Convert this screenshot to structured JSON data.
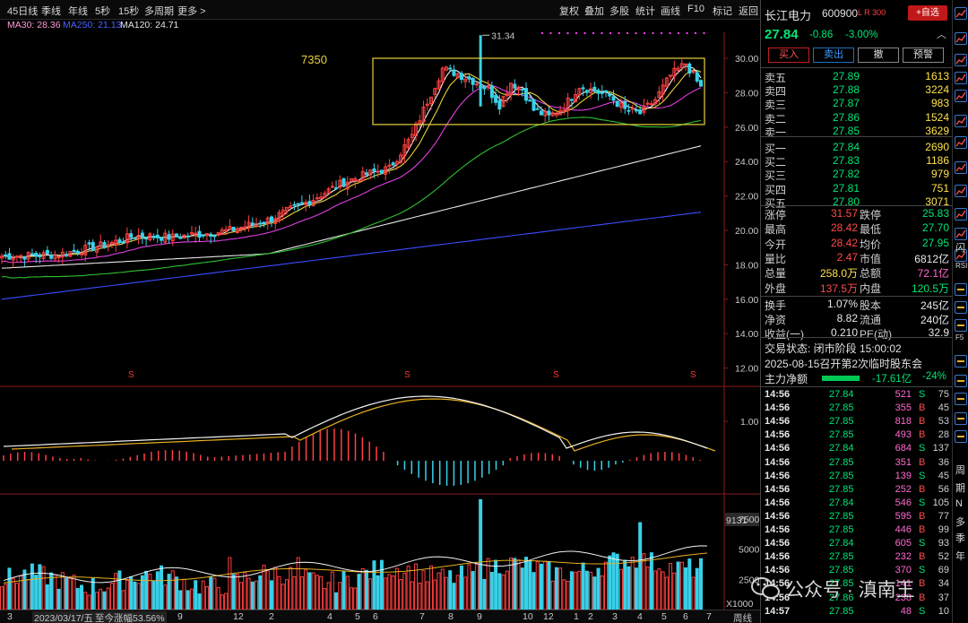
{
  "toolbar": {
    "left": [
      "45日线",
      "季线",
      "年线",
      "5秒",
      "15秒",
      "多周期",
      "更多"
    ],
    "right": [
      "复权",
      "叠加",
      "多股",
      "统计",
      "画线",
      "F10",
      "标记",
      "返回"
    ]
  },
  "ma_legend": {
    "ma30": "MA30: 28.36",
    "ma250": "MA250: 21.13",
    "ma120": "MA120: 24.71",
    "ma30_color": "#ff9ad5",
    "ma250_color": "#4a64ff",
    "ma120_color": "#e6e6e6"
  },
  "main_chart": {
    "y_ticks": [
      "30.00",
      "28.00",
      "26.00",
      "24.00",
      "22.00",
      "20.00",
      "18.00",
      "16.00",
      "14.00",
      "12.00"
    ],
    "box_label": "7350",
    "high_label": "31.34",
    "s_marker": "S"
  },
  "macd": {
    "tick": "1.00"
  },
  "volume": {
    "top_label": "9131",
    "ticks": [
      "7500",
      "5000",
      "2500"
    ],
    "unit": "X1000"
  },
  "bottom_bar": {
    "date": "2023/03/17/五",
    "change": "至今涨幅53.56%",
    "months": [
      "3",
      "9",
      "12",
      "2",
      "4",
      "5",
      "6",
      "7",
      "8",
      "9",
      "10",
      "12",
      "1",
      "2",
      "3",
      "4",
      "5",
      "6",
      "7"
    ],
    "period": "周线"
  },
  "quote": {
    "name": "长江电力",
    "code": "600900",
    "flags": "L R 300",
    "add_button": "+自选",
    "price": "27.84",
    "change": "-0.86",
    "change_pct": "-3.00%",
    "chevron": "︿",
    "buy": "买入",
    "sell": "卖出",
    "cancel": "撤",
    "preorder": "预警"
  },
  "order_book": {
    "asks": [
      {
        "label": "卖五",
        "price": "27.89",
        "vol": "1613"
      },
      {
        "label": "卖四",
        "price": "27.88",
        "vol": "3224"
      },
      {
        "label": "卖三",
        "price": "27.87",
        "vol": "983"
      },
      {
        "label": "卖二",
        "price": "27.86",
        "vol": "1524"
      },
      {
        "label": "卖一",
        "price": "27.85",
        "vol": "3629"
      }
    ],
    "bids": [
      {
        "label": "买一",
        "price": "27.84",
        "vol": "2690"
      },
      {
        "label": "买二",
        "price": "27.83",
        "vol": "1186"
      },
      {
        "label": "买三",
        "price": "27.82",
        "vol": "979"
      },
      {
        "label": "买四",
        "price": "27.81",
        "vol": "751"
      },
      {
        "label": "买五",
        "price": "27.80",
        "vol": "3071"
      }
    ]
  },
  "stats": [
    {
      "l1": "涨停",
      "v1": "31.57",
      "c1": "#ff4a4a",
      "l2": "跌停",
      "v2": "25.83",
      "c2": "#00e676"
    },
    {
      "l1": "最高",
      "v1": "28.42",
      "c1": "#ff4a4a",
      "l2": "最低",
      "v2": "27.70",
      "c2": "#00e676"
    },
    {
      "l1": "今开",
      "v1": "28.42",
      "c1": "#ff4a4a",
      "l2": "均价",
      "v2": "27.95",
      "c2": "#00e676"
    },
    {
      "l1": "量比",
      "v1": "2.47",
      "c1": "#ff4a4a",
      "l2": "市值",
      "v2": "6812亿",
      "c2": "#e8e8e8"
    },
    {
      "l1": "总量",
      "v1": "258.0万",
      "c1": "#ffe24a",
      "l2": "总额",
      "v2": "72.1亿",
      "c2": "#ff6ad0"
    },
    {
      "l1": "外盘",
      "v1": "137.5万",
      "c1": "#ff4a4a",
      "l2": "内盘",
      "v2": "120.5万",
      "c2": "#00e676"
    },
    {
      "l1": "换手",
      "v1": "1.07%",
      "c1": "#e8e8e8",
      "l2": "股本",
      "v2": "245亿",
      "c2": "#e8e8e8"
    },
    {
      "l1": "净资",
      "v1": "8.82",
      "c1": "#e8e8e8",
      "l2": "流通",
      "v2": "240亿",
      "c2": "#e8e8e8"
    },
    {
      "l1": "收益(一)",
      "v1": "0.210",
      "c1": "#e8e8e8",
      "l2": "PE(动)",
      "v2": "32.9",
      "c2": "#e8e8e8"
    }
  ],
  "status": {
    "trade_state": "交易状态: 闭市阶段 15:00:02",
    "announcement": "2025-08-15召开第2次临时股东会",
    "net_flow_label": "主力净额",
    "net_flow_value": "-17.61亿",
    "net_flow_pct": "-24%"
  },
  "ticks": [
    {
      "t": "14:56",
      "p": "27.84",
      "v": "521",
      "d": "S",
      "n": "75"
    },
    {
      "t": "14:56",
      "p": "27.85",
      "v": "355",
      "d": "B",
      "n": "45"
    },
    {
      "t": "14:56",
      "p": "27.85",
      "v": "818",
      "d": "B",
      "n": "53"
    },
    {
      "t": "14:56",
      "p": "27.85",
      "v": "493",
      "d": "B",
      "n": "28"
    },
    {
      "t": "14:56",
      "p": "27.84",
      "v": "684",
      "d": "S",
      "n": "137"
    },
    {
      "t": "14:56",
      "p": "27.85",
      "v": "351",
      "d": "B",
      "n": "36"
    },
    {
      "t": "14:56",
      "p": "27.85",
      "v": "139",
      "d": "S",
      "n": "45"
    },
    {
      "t": "14:56",
      "p": "27.85",
      "v": "252",
      "d": "B",
      "n": "56"
    },
    {
      "t": "14:56",
      "p": "27.84",
      "v": "546",
      "d": "S",
      "n": "105"
    },
    {
      "t": "14:56",
      "p": "27.85",
      "v": "595",
      "d": "B",
      "n": "77"
    },
    {
      "t": "14:56",
      "p": "27.85",
      "v": "446",
      "d": "B",
      "n": "99"
    },
    {
      "t": "14:56",
      "p": "27.84",
      "v": "605",
      "d": "S",
      "n": "93"
    },
    {
      "t": "14:56",
      "p": "27.85",
      "v": "232",
      "d": "B",
      "n": "52"
    },
    {
      "t": "14:56",
      "p": "27.85",
      "v": "370",
      "d": "S",
      "n": "69"
    },
    {
      "t": "14:56",
      "p": "27.85",
      "v": "141",
      "d": "B",
      "n": "34"
    },
    {
      "t": "14:56",
      "p": "27.86",
      "v": "238",
      "d": "B",
      "n": "37"
    },
    {
      "t": "14:57",
      "p": "27.85",
      "v": "48",
      "d": "S",
      "n": "10"
    }
  ],
  "side_icons": {
    "labels": [
      "闪",
      "RSI",
      "F5",
      "周",
      "期",
      "N",
      "多",
      "季",
      "年"
    ]
  },
  "watermark": "公众号 · 滇南王",
  "colors": {
    "up": "#ff4a4a",
    "down": "#00e676",
    "volume_ask": "#ffe24a",
    "candle_up": "#ff4040",
    "candle_down": "#39d0e8",
    "box": "#e8d23a"
  }
}
